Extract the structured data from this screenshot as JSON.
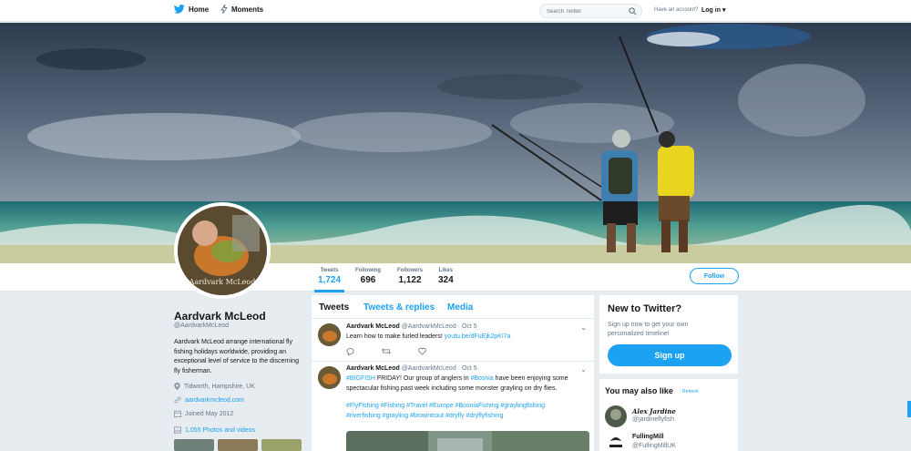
{
  "nav": {
    "home_label": "Home",
    "moments_label": "Moments",
    "search_placeholder": "Search Twitter",
    "account_text": "Have an account?",
    "login_label": "Log in",
    "login_caret": "▾",
    "brand_color": "#1da1f2"
  },
  "profile": {
    "name": "Aardvark McLeod",
    "handle": "@AardvarkMcLeod",
    "avatar_caption": "Aardvark McLeod",
    "bio": "Aardvark McLeod arrange international fly fishing holidays worldwide, providing an exceptional level of service to the discerning fly fisherman.",
    "location": "Tidworth, Hampshire, UK",
    "website": "aardvarkmcleod.com",
    "joined": "Joined May 2012",
    "photos_label": "1,055 Photos and videos"
  },
  "stats": [
    {
      "label": "Tweets",
      "value": "1,724"
    },
    {
      "label": "Following",
      "value": "696"
    },
    {
      "label": "Followers",
      "value": "1,122"
    },
    {
      "label": "Likes",
      "value": "324"
    }
  ],
  "follow_label": "Follow",
  "timeline": {
    "tabs": [
      "Tweets",
      "Tweets & replies",
      "Media"
    ],
    "tweets": [
      {
        "name": "Aardvark McLeod",
        "handle": "@AardvarkMcLeod · Oct 5",
        "text": "Learn how to make furled leaders!",
        "link": "youtu.be/dFuEjk2pKI7a"
      },
      {
        "name": "Aardvark McLeod",
        "handle": "@AardvarkMcLeod · Oct 5",
        "tag1": "#BIGFISH",
        "text1": " FRIDAY! Our group of anglers in ",
        "tag2": "#Bosnia",
        "text2": " have been enjoying some spectacular fishing past week including some monster grayling on dry flies.",
        "hashtags1": "#FlyFishing #Fishing #Travel #Europe #BosniaFishing #graylingfishing",
        "hashtags2": "#riverfishing #grayling #browntrout #dryfly #dryflyfishing"
      }
    ]
  },
  "signup": {
    "title": "New to Twitter?",
    "text": "Sign up now to get your own personalized timeline!",
    "button": "Sign up"
  },
  "suggestions": {
    "title": "You may also like",
    "refresh": "· Refresh",
    "people": [
      {
        "name": "Alex Jardine",
        "handle": "@jardineflyfish"
      },
      {
        "name": "FullingMill",
        "handle": "@FullingMillUK"
      }
    ]
  }
}
